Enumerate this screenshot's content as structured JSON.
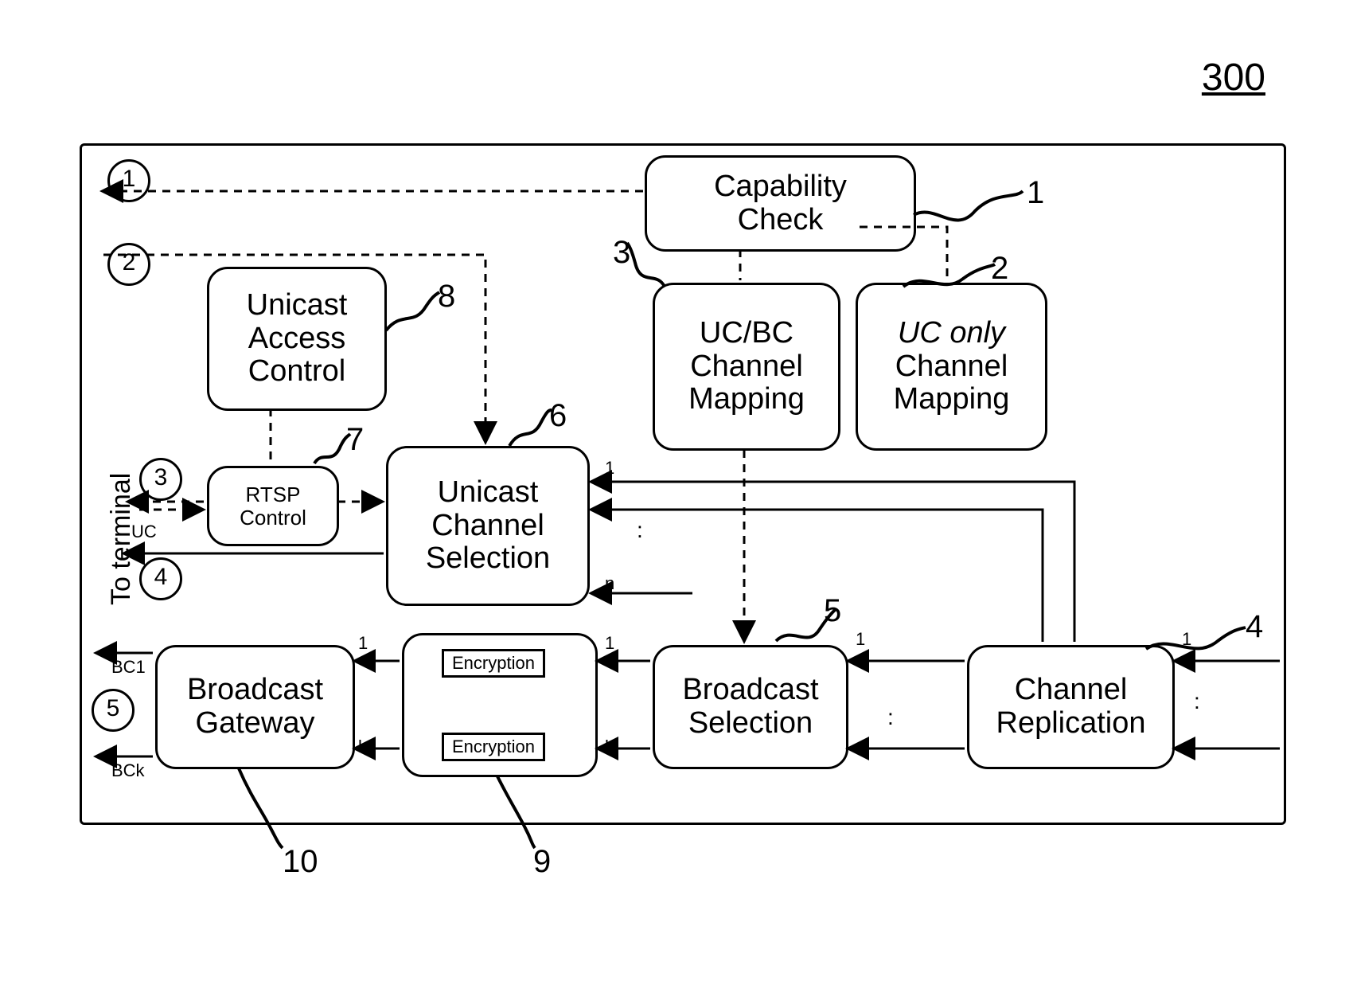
{
  "figure_number": "300",
  "steps": {
    "s1": "1",
    "s2": "2",
    "s3": "3",
    "s4": "4",
    "s5": "5"
  },
  "refs": {
    "r1": "1",
    "r2": "2",
    "r3": "3",
    "r4": "4",
    "r5": "5",
    "r6": "6",
    "r7": "7",
    "r8": "8",
    "r9": "9",
    "r10": "10"
  },
  "boxes": {
    "capability_check": "Capability\nCheck",
    "uc_bc_mapping": "UC/BC\nChannel\nMapping",
    "uc_only_prefix": "UC only",
    "uc_only_rest": "\nChannel\nMapping",
    "unicast_access_control": "Unicast\nAccess\nControl",
    "rtsp_control": "RTSP\nControl",
    "unicast_channel_selection": "Unicast\nChannel\nSelection",
    "broadcast_selection": "Broadcast\nSelection",
    "channel_replication": "Channel\nReplication",
    "broadcast_gateway": "Broadcast\nGateway",
    "encryption": "Encryption"
  },
  "labels": {
    "to_terminal": "To terminal",
    "uc": "UC",
    "bc1": "BC1",
    "bck": "BCk",
    "one": "1",
    "k": "k",
    "n": "n",
    "colon": ":"
  }
}
